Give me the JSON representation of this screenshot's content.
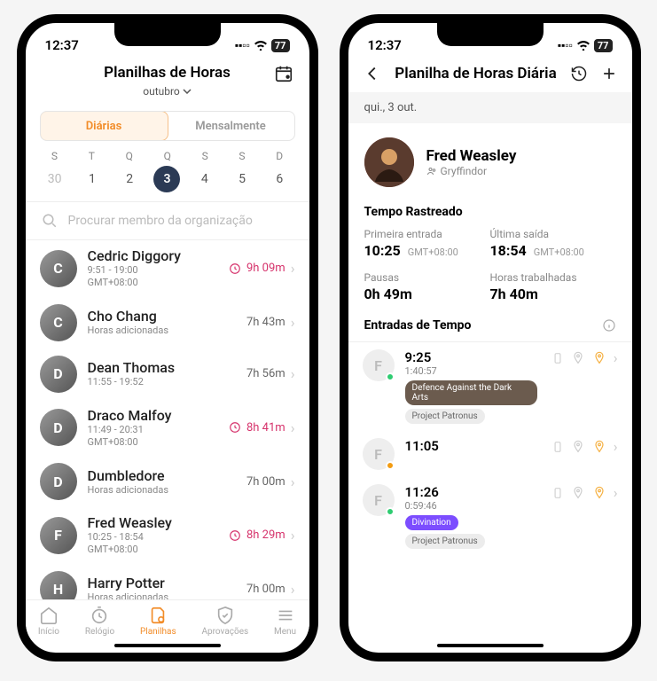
{
  "status": {
    "time": "12:37",
    "battery": "77"
  },
  "left": {
    "title": "Planilhas de Horas",
    "month": "outubro",
    "tabs": {
      "daily": "Diárias",
      "monthly": "Mensalmente"
    },
    "week": [
      "S",
      "T",
      "Q",
      "Q",
      "S",
      "S",
      "D"
    ],
    "dates": [
      "30",
      "1",
      "2",
      "3",
      "4",
      "5",
      "6"
    ],
    "selected_index": 3,
    "search_placeholder": "Procurar membro da organização",
    "members": [
      {
        "name": "Cedric Diggory",
        "line1": "9:51 - 19:00",
        "line2": "GMT+08:00",
        "duration": "9h 09m",
        "warn": true
      },
      {
        "name": "Cho Chang",
        "line1": "Horas adicionadas",
        "line2": "",
        "duration": "7h 43m",
        "warn": false
      },
      {
        "name": "Dean Thomas",
        "line1": "11:55 - 19:52",
        "line2": "",
        "duration": "7h 56m",
        "warn": false
      },
      {
        "name": "Draco Malfoy",
        "line1": "11:49 - 20:31",
        "line2": "GMT+08:00",
        "duration": "8h 41m",
        "warn": true
      },
      {
        "name": "Dumbledore",
        "line1": "Horas adicionadas",
        "line2": "",
        "duration": "7h 00m",
        "warn": false
      },
      {
        "name": "Fred Weasley",
        "line1": "10:25 - 18:54",
        "line2": "GMT+08:00",
        "duration": "8h 29m",
        "warn": true
      },
      {
        "name": "Harry Potter",
        "line1": "Horas adicionadas",
        "line2": "",
        "duration": "7h 00m",
        "warn": false
      }
    ],
    "tabs_bottom": {
      "home": "Início",
      "clock": "Relógio",
      "sheets": "Planilhas",
      "approvals": "Aprovações",
      "menu": "Menu"
    }
  },
  "right": {
    "title": "Planilha de Horas Diária",
    "date_label": "qui., 3 out.",
    "user": {
      "name": "Fred Weasley",
      "team": "Gryffindor"
    },
    "tracked_title": "Tempo Rastreado",
    "first_in_label": "Primeira entrada",
    "first_in": "10:25",
    "tz": "GMT+08:00",
    "last_out_label": "Última saída",
    "last_out": "18:54",
    "breaks_label": "Pausas",
    "breaks": "0h 49m",
    "worked_label": "Horas trabalhadas",
    "worked": "7h 40m",
    "entries_title": "Entradas de Tempo",
    "entries": [
      {
        "initial": "F",
        "status": "green",
        "time": "9:25",
        "duration": "1:40:57",
        "tag1": "Defence Against the Dark Arts",
        "tag2": "Project Patronus"
      },
      {
        "initial": "F",
        "status": "orange",
        "time": "11:05",
        "duration": "",
        "tag1": "",
        "tag2": ""
      },
      {
        "initial": "F",
        "status": "green",
        "time": "11:26",
        "duration": "0:59:46",
        "tag1": "Divination",
        "tag2": "Project Patronus"
      }
    ]
  }
}
